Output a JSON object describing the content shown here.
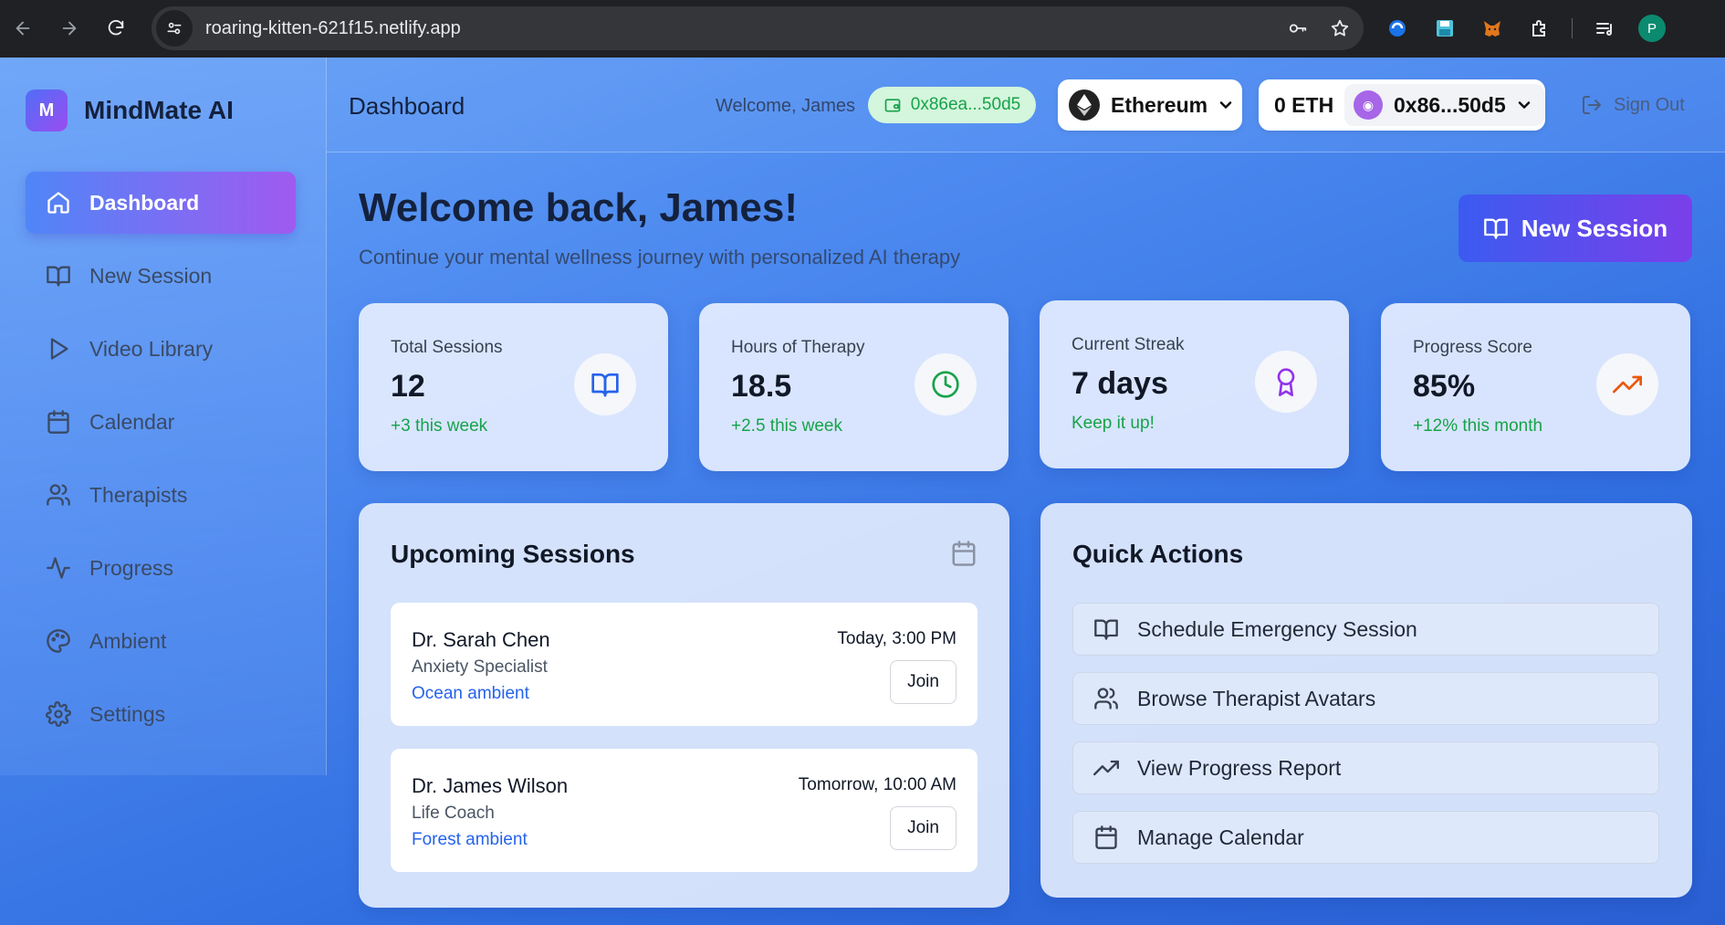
{
  "browser": {
    "url": "roaring-kitten-621f15.netlify.app",
    "profile_initial": "P"
  },
  "brand": {
    "logo_letter": "M",
    "name": "MindMate AI"
  },
  "sidebar": {
    "items": [
      {
        "label": "Dashboard",
        "icon": "home-icon",
        "active": true
      },
      {
        "label": "New Session",
        "icon": "book-icon"
      },
      {
        "label": "Video Library",
        "icon": "play-icon"
      },
      {
        "label": "Calendar",
        "icon": "calendar-icon"
      },
      {
        "label": "Therapists",
        "icon": "users-icon"
      },
      {
        "label": "Progress",
        "icon": "activity-icon"
      },
      {
        "label": "Ambient",
        "icon": "palette-icon"
      },
      {
        "label": "Settings",
        "icon": "gear-icon"
      }
    ]
  },
  "header": {
    "title": "Dashboard",
    "welcome": "Welcome, James",
    "wallet_short": "0x86ea...50d5",
    "network": "Ethereum",
    "balance": "0 ETH",
    "account": "0x86...50d5",
    "signout": "Sign Out"
  },
  "main": {
    "welcome_title": "Welcome back, James!",
    "welcome_subtitle": "Continue your mental wellness journey with personalized AI therapy",
    "cta_label": "New Session",
    "stats": [
      {
        "label": "Total Sessions",
        "value": "12",
        "delta": "+3 this week",
        "icon": "book-icon",
        "icon_color": "#2563eb"
      },
      {
        "label": "Hours of Therapy",
        "value": "18.5",
        "delta": "+2.5 this week",
        "icon": "clock-icon",
        "icon_color": "#16a34a"
      },
      {
        "label": "Current Streak",
        "value": "7 days",
        "delta": "Keep it up!",
        "icon": "award-icon",
        "icon_color": "#9333ea"
      },
      {
        "label": "Progress Score",
        "value": "85%",
        "delta": "+12% this month",
        "icon": "trending-up-icon",
        "icon_color": "#ea580c"
      }
    ],
    "upcoming": {
      "title": "Upcoming Sessions",
      "join_label": "Join",
      "sessions": [
        {
          "name": "Dr. Sarah Chen",
          "role": "Anxiety Specialist",
          "ambient": "Ocean ambient",
          "time": "Today, 3:00 PM"
        },
        {
          "name": "Dr. James Wilson",
          "role": "Life Coach",
          "ambient": "Forest ambient",
          "time": "Tomorrow, 10:00 AM"
        }
      ]
    },
    "quick_actions": {
      "title": "Quick Actions",
      "items": [
        {
          "label": "Schedule Emergency Session",
          "icon": "book-icon"
        },
        {
          "label": "Browse Therapist Avatars",
          "icon": "users-icon"
        },
        {
          "label": "View Progress Report",
          "icon": "trending-up-icon"
        },
        {
          "label": "Manage Calendar",
          "icon": "calendar-icon"
        }
      ]
    }
  }
}
